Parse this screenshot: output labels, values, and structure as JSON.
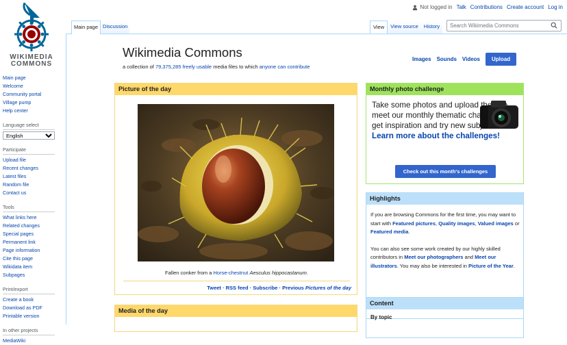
{
  "personal": {
    "not_logged_in": "Not logged in",
    "talk": "Talk",
    "contributions": "Contributions",
    "create_account": "Create account",
    "login": "Log in"
  },
  "logo": {
    "line1": "WIKIMEDIA",
    "line2": "COMMONS"
  },
  "sidebar": {
    "nav": [
      "Main page",
      "Welcome",
      "Community portal",
      "Village pump",
      "Help center"
    ],
    "language_header": "Language select",
    "language_value": "English",
    "participate_header": "Participate",
    "participate": [
      "Upload file",
      "Recent changes",
      "Latest files",
      "Random file",
      "Contact us"
    ],
    "tools_header": "Tools",
    "tools": [
      "What links here",
      "Related changes",
      "Special pages",
      "Permanent link",
      "Page information",
      "Cite this page",
      "Wikidata item",
      "Subpages"
    ],
    "print_header": "Print/export",
    "print": [
      "Create a book",
      "Download as PDF",
      "Printable version"
    ],
    "projects_header": "In other projects",
    "projects": [
      "MediaWiki"
    ]
  },
  "tabs": {
    "main_page": "Main page",
    "discussion": "Discussion",
    "view": "View",
    "view_source": "View source",
    "history": "History"
  },
  "search": {
    "placeholder": "Search Wikimedia Commons"
  },
  "page": {
    "title": "Wikimedia Commons",
    "subtitle_pre": "a collection of ",
    "subtitle_link": "79,375,285 freely usable",
    "subtitle_mid": " media files to which ",
    "subtitle_link2": "anyone can contribute"
  },
  "media_links": {
    "images": "Images",
    "sounds": "Sounds",
    "videos": "Videos",
    "upload": "Upload"
  },
  "potd": {
    "header": "Picture of the day",
    "caption_pre": "Fallen conker from a ",
    "caption_link": "Horse-chestnut",
    "caption_italic": "Aesculus hippocastanum",
    "caption_end": ".",
    "links": "Tweet · RSS feed · Subscribe · Previous ",
    "links_italic": "Pictures of the day"
  },
  "motd": {
    "header": "Media of the day"
  },
  "mpc": {
    "header": "Monthly photo challenge",
    "text": "Take some photos and upload them to meet our monthly thematic challenge, get inspiration and try new subjects! ",
    "link": "Learn more about the challenges!",
    "button": "Check out this month's challenges"
  },
  "highlights": {
    "header": "Highlights",
    "p1_a": "If you are browsing Commons for the first time, you may want to start with ",
    "p1_b": "Featured pictures",
    "p1_c": ", ",
    "p1_d": "Quality images",
    "p1_e": ", ",
    "p1_f": "Valued images",
    "p1_g": " or ",
    "p1_h": "Featured media",
    "p1_i": ".",
    "p2_a": "You can also see some work created by our highly skilled contributors in ",
    "p2_b": "Meet our photographers",
    "p2_c": " and ",
    "p2_d": "Meet our illustrators",
    "p2_e": ". You may also be interested in ",
    "p2_f": "Picture of the Year",
    "p2_g": "."
  },
  "content": {
    "header": "Content",
    "by_topic": "By topic"
  },
  "colors": {
    "link": "#0645ad",
    "button": "#3366cc",
    "potd_header": "#ffd86b",
    "mpc_header": "#9fe35c",
    "blue_header": "#bde0fa"
  }
}
